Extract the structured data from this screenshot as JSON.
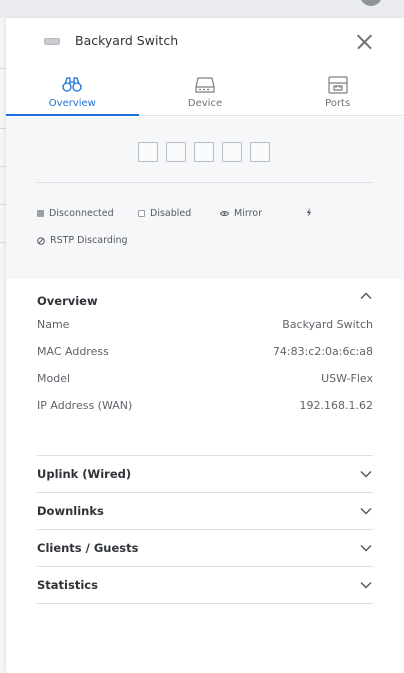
{
  "header": {
    "title": "Backyard Switch"
  },
  "tabs": [
    {
      "label": "Overview",
      "icon": "binoculars-icon",
      "active": true
    },
    {
      "label": "Device",
      "icon": "device-icon",
      "active": false
    },
    {
      "label": "Ports",
      "icon": "ports-icon",
      "active": false
    }
  ],
  "ports": {
    "count": 5
  },
  "legend": {
    "disconnected": "Disconnected",
    "disabled": "Disabled",
    "mirror": "Mirror",
    "rstp": "RSTP Discarding"
  },
  "overview": {
    "title": "Overview",
    "rows": [
      {
        "key": "Name",
        "value": "Backyard Switch"
      },
      {
        "key": "MAC Address",
        "value": "74:83:c2:0a:6c:a8"
      },
      {
        "key": "Model",
        "value": "USW-Flex"
      },
      {
        "key": "IP Address (WAN)",
        "value": "192.168.1.62"
      }
    ]
  },
  "sections": [
    {
      "title": "Uplink (Wired)"
    },
    {
      "title": "Downlinks"
    },
    {
      "title": "Clients / Guests"
    },
    {
      "title": "Statistics"
    }
  ],
  "colors": {
    "accent": "#1c6fd8",
    "panel_bg": "#ffffff",
    "ports_bg": "#f6f7f8"
  }
}
